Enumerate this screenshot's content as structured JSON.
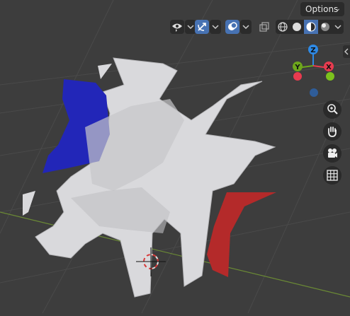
{
  "header": {
    "options_label": "Options",
    "options_chevron": "⌄"
  },
  "gizmo": {
    "z_label": "Z",
    "y_label": "Y",
    "x_label": "X",
    "colors": {
      "x": "#e83b4f",
      "y": "#6ea71c",
      "z": "#2e8ae6"
    }
  },
  "icons": [
    "visibility-icon",
    "gizmo-icon",
    "overlay-icon",
    "xray-icon",
    "wireframe-shading-icon",
    "solid-shading-icon",
    "material-shading-icon",
    "rendered-shading-icon",
    "zoom-icon",
    "hand-icon",
    "camera-icon",
    "grid-icon"
  ]
}
